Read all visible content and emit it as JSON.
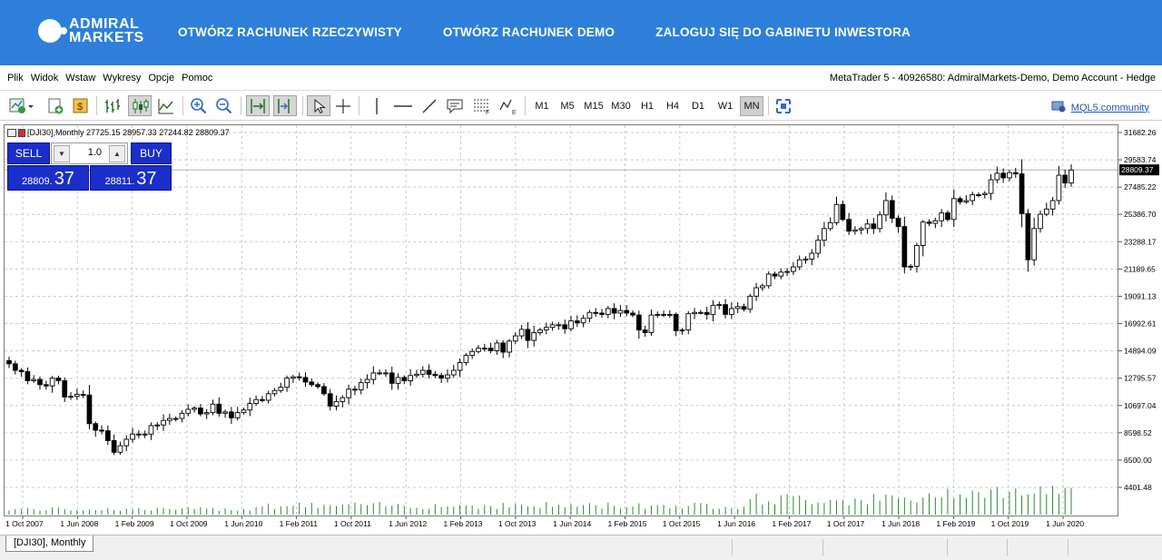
{
  "brand": {
    "line1": "ADMIRAL",
    "line2": "MARKETS"
  },
  "topnav": [
    "OTWÓRZ RACHUNEK RZECZYWISTY",
    "OTWÓRZ RACHUNEK DEMO",
    "ZALOGUJ SIĘ DO GABINETU INWESTORA"
  ],
  "menu": [
    "Plik",
    "Widok",
    "Wstaw",
    "Wykresy",
    "Opcje",
    "Pomoc"
  ],
  "window_title": "MetaTrader 5 - 40926580: AdmiralMarkets-Demo, Demo Account - Hedge",
  "timeframes": [
    "M1",
    "M5",
    "M15",
    "M30",
    "H1",
    "H4",
    "D1",
    "W1",
    "MN"
  ],
  "active_timeframe": "MN",
  "mql_link": "MQL5.community",
  "chart_header": "[DJI30],Monthly  27725.15 28957.33 27244.82 28809.37",
  "trade_panel": {
    "sell_label": "SELL",
    "buy_label": "BUY",
    "lot": "1.0",
    "sell_price_small": "28809.",
    "sell_price_big": "37",
    "buy_price_small": "28811.",
    "buy_price_big": "37"
  },
  "chart_tab": "[DJI30], Monthly",
  "colors": {
    "brand_blue": "#2d7fd9",
    "panel_blue": "#1a2ec9",
    "volume": "#2a8a2a"
  },
  "chart_data": {
    "type": "candlestick",
    "symbol": "DJI30",
    "timeframe": "Monthly",
    "current_price": 28809.37,
    "ylim": [
      4401.48,
      31682.26
    ],
    "y_ticks": [
      "31682.26",
      "29583.74",
      "27485.22",
      "25386.70",
      "23288.17",
      "21189.65",
      "19091.13",
      "16992.61",
      "14894.09",
      "12795.57",
      "10697.04",
      "8598.52",
      "6500.00",
      "4401.48"
    ],
    "x_ticks": [
      "1 Oct 2007",
      "1 Jun 2008",
      "1 Feb 2009",
      "1 Oct 2009",
      "1 Jun 2010",
      "1 Feb 2011",
      "1 Oct 2011",
      "1 Jun 2012",
      "1 Feb 2013",
      "1 Oct 2013",
      "1 Jun 2014",
      "1 Feb 2015",
      "1 Oct 2015",
      "1 Jun 2016",
      "1 Feb 2017",
      "1 Oct 2017",
      "1 Jun 2018",
      "1 Feb 2019",
      "1 Oct 2019",
      "1 Jun 2020"
    ],
    "closes_approx": [
      13900,
      13400,
      13300,
      12600,
      12700,
      12300,
      12200,
      12800,
      12600,
      11350,
      11400,
      11550,
      11500,
      9300,
      8800,
      8750,
      8000,
      7100,
      7600,
      8100,
      8500,
      8450,
      8500,
      9150,
      9200,
      9550,
      9700,
      9700,
      10100,
      10400,
      10500,
      10050,
      10150,
      10800,
      10100,
      10200,
      9750,
      10150,
      10350,
      10850,
      11150,
      11100,
      11600,
      11850,
      12100,
      12800,
      12900,
      12850,
      12500,
      12300,
      12150,
      11600,
      10650,
      11000,
      11300,
      11950,
      11900,
      12450,
      12700,
      13200,
      13200,
      13200,
      12400,
      12850,
      12600,
      13000,
      13100,
      13400,
      13100,
      13000,
      12800,
      13050,
      13400,
      14000,
      14550,
      14850,
      15100,
      15100,
      14900,
      15500,
      14800,
      15650,
      16050,
      16550,
      15700,
      16300,
      16500,
      16700,
      16900,
      16900,
      16600,
      17200,
      17050,
      17400,
      17850,
      17800,
      17700,
      18150,
      17800,
      18000,
      17800,
      17650,
      16500,
      16300,
      17650,
      17700,
      17700,
      17700,
      16450,
      16500,
      17750,
      17850,
      17850,
      17700,
      18400,
      18450,
      17700,
      18150,
      18300,
      18100,
      19100,
      19750,
      19900,
      20800,
      20650,
      20950,
      21000,
      21350,
      21900,
      21950,
      22400,
      23400,
      24300,
      24750,
      26150,
      25000,
      24100,
      24200,
      24300,
      24650,
      24300,
      25350,
      26450,
      25100,
      24450,
      21350,
      21400,
      23000,
      24800,
      24700,
      24900,
      25500,
      25000,
      26600,
      26350,
      26450,
      26900,
      26900,
      27000,
      28050,
      28550,
      28200,
      28600,
      28500,
      25450,
      21900,
      24300,
      25400,
      25800,
      26450,
      28400,
      27800,
      28800
    ],
    "volume_bars_visible": true
  }
}
